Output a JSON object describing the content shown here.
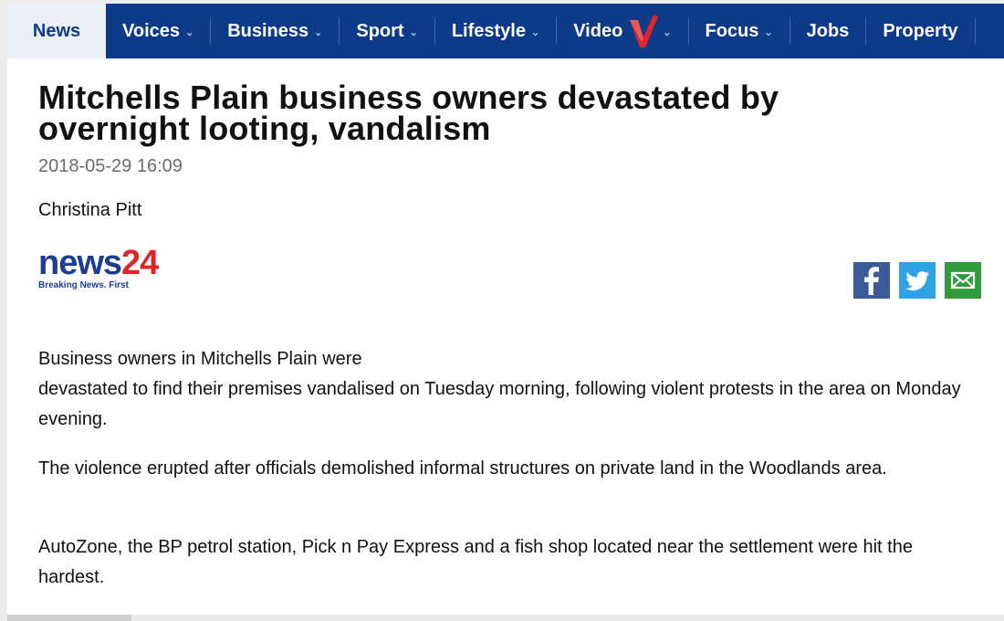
{
  "nav": {
    "items": [
      {
        "label": "News",
        "active": true,
        "dropdown": false
      },
      {
        "label": "Voices",
        "dropdown": true
      },
      {
        "label": "Business",
        "dropdown": true
      },
      {
        "label": "Sport",
        "dropdown": true
      },
      {
        "label": "Lifestyle",
        "dropdown": true
      },
      {
        "label": "Video",
        "dropdown": true
      },
      {
        "label": "Focus",
        "dropdown": true
      },
      {
        "label": "Jobs",
        "dropdown": false
      },
      {
        "label": "Property",
        "dropdown": false
      }
    ],
    "chevron": "⌄",
    "colors": {
      "background": "#0e3a8a",
      "active_bg": "#e9eef7",
      "video_logo": "#e0252a"
    }
  },
  "article": {
    "title": "Mitchells Plain business owners devastated by overnight looting, vandalism",
    "date": "2018-05-29 16:09",
    "author": "Christina Pitt",
    "paragraphs": [
      "Business owners in Mitchells Plain were\ndevastated to find their premises vandalised on Tuesday morning, following violent protests in the area on Monday evening.",
      "The violence erupted after officials demolished informal structures on private land in the Woodlands area.",
      "AutoZone, the BP petrol station, Pick n Pay Express and a fish shop located near the settlement were hit the hardest."
    ]
  },
  "logo": {
    "news": "news",
    "num": "24",
    "tagline": "Breaking News. First",
    "colors": {
      "news": "#1b3f8f",
      "num": "#e0252a"
    }
  },
  "share": {
    "icons": [
      "facebook-icon",
      "twitter-icon",
      "email-icon"
    ],
    "colors": {
      "facebook": "#3b5a98",
      "twitter": "#2ea3e6",
      "email": "#2f9b3b"
    }
  }
}
